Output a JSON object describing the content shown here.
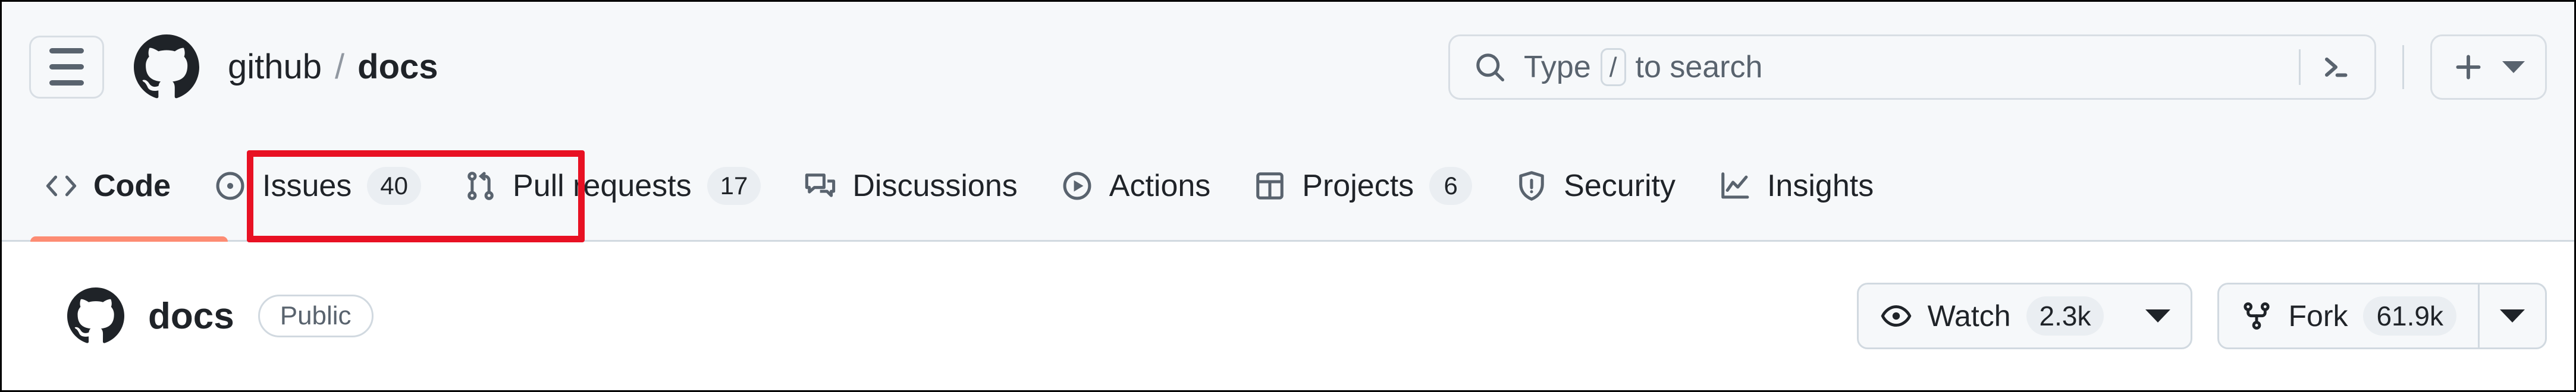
{
  "topbar": {
    "menu_button": "menu-hamburger",
    "logo": "github-logo",
    "breadcrumb": {
      "owner": "github",
      "separator": "/",
      "repo": "docs"
    },
    "search": {
      "placeholder_prefix": "Type",
      "kbd_shortcut": "/",
      "placeholder_suffix": "to search",
      "search_icon": "search-icon",
      "terminal_icon": "terminal-icon"
    },
    "create_button": {
      "icon": "plus-icon",
      "caret": "chevron-down-icon"
    }
  },
  "nav": {
    "tabs": [
      {
        "label": "Code",
        "icon": "code-icon",
        "count": null,
        "active": true
      },
      {
        "label": "Issues",
        "icon": "issue-opened-icon",
        "count": "40",
        "active": false
      },
      {
        "label": "Pull requests",
        "icon": "git-pull-request-icon",
        "count": "17",
        "active": false
      },
      {
        "label": "Discussions",
        "icon": "comment-discussion-icon",
        "count": null,
        "active": false
      },
      {
        "label": "Actions",
        "icon": "play-icon",
        "count": null,
        "active": false
      },
      {
        "label": "Projects",
        "icon": "table-icon",
        "count": "6",
        "active": false
      },
      {
        "label": "Security",
        "icon": "shield-icon",
        "count": null,
        "active": false
      },
      {
        "label": "Insights",
        "icon": "graph-icon",
        "count": null,
        "active": false
      }
    ],
    "annotation": {
      "target": "Issues",
      "color": "#e81123"
    },
    "active_underline_color": "#fd8c73"
  },
  "repo": {
    "avatar_icon": "github-mark-icon",
    "name": "docs",
    "visibility": "Public",
    "watch": {
      "label": "Watch",
      "count": "2.3k",
      "icon": "eye-icon",
      "caret": "chevron-down-icon"
    },
    "fork": {
      "label": "Fork",
      "count": "61.9k",
      "icon": "repo-forked-icon",
      "caret": "chevron-down-icon"
    }
  },
  "colors": {
    "header_bg": "#f6f8fa",
    "body_bg": "#ffffff",
    "border": "#d1d9e0",
    "text": "#1f2328",
    "muted": "#59636e",
    "badge_bg": "#eaeef2",
    "accent_underline": "#fd8c73",
    "annotation_red": "#e81123"
  }
}
